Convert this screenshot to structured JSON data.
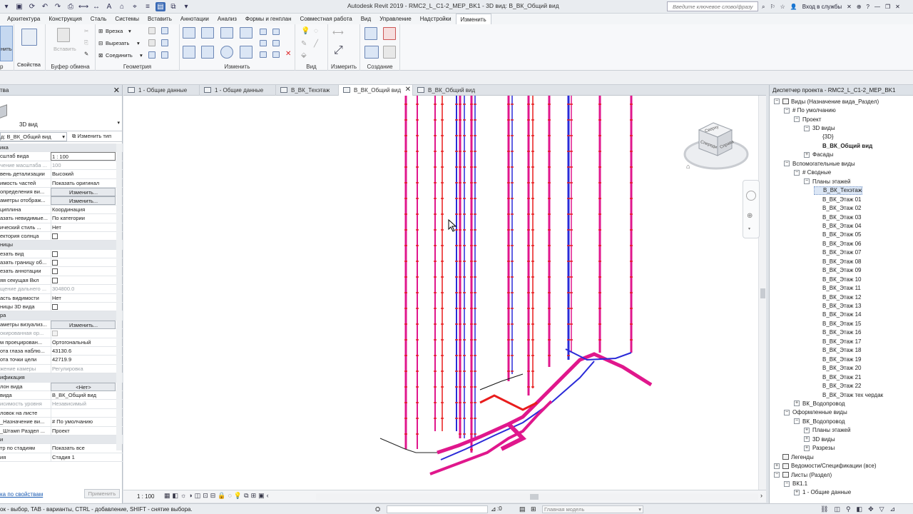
{
  "app": {
    "title": "Autodesk Revit 2019 - RMC2_L_C1-2_MEP_BK1 - 3D вид: B_ВК_Общий вид",
    "search_placeholder": "Введите ключевое слово/фразу",
    "signin": "Вход в службы"
  },
  "ribbon_tabs": [
    "Архитектура",
    "Конструкция",
    "Сталь",
    "Системы",
    "Вставить",
    "Аннотации",
    "Анализ",
    "Формы и генплан",
    "Совместная работа",
    "Вид",
    "Управление",
    "Надстройки",
    "Изменить"
  ],
  "ribbon_active_tab": "Изменить",
  "ribbon": {
    "modify_partial": "нить",
    "properties_label": "Свойства",
    "select_partial": "р",
    "clipboard_label": "Буфер обмена",
    "paste_label": "Вставить",
    "geometry_label": "Геометрия",
    "cut_label": "Врезка",
    "cutout_label": "Вырезать",
    "join_label": "Соединить",
    "modify_label": "Изменить",
    "view_label": "Вид",
    "measure_label": "Измерить",
    "create_label": "Создание"
  },
  "props": {
    "header": "тва",
    "type_name": "3D вид",
    "instance_select": "д: B_ВК_Общий вид",
    "edit_type": "Изменить тип",
    "rows": [
      {
        "kind": "group",
        "name": "ика"
      },
      {
        "name": "сштаб вида",
        "value": "1 : 100",
        "style": "boxed"
      },
      {
        "name": "чение масштаба ...",
        "value": "100",
        "style": "dis"
      },
      {
        "name": "вень детализации",
        "value": "Высокий"
      },
      {
        "name": "имость частей",
        "value": "Показать оригинал"
      },
      {
        "name": "определения ви...",
        "value": "Изменить...",
        "style": "btn"
      },
      {
        "name": "аметры отображ...",
        "value": "Изменить...",
        "style": "btn"
      },
      {
        "name": "циплина",
        "value": "Координация"
      },
      {
        "name": "азать невидимые...",
        "value": "По категории"
      },
      {
        "name": "ический стиль ...",
        "value": "Нет"
      },
      {
        "name": "ектория солнца",
        "value": "",
        "check": "on"
      },
      {
        "kind": "group",
        "name": "ницы"
      },
      {
        "name": "езать вид",
        "value": "",
        "check": "on"
      },
      {
        "name": "азать границу об...",
        "value": "",
        "check": "on"
      },
      {
        "name": "езать аннотации",
        "value": "",
        "check": "on"
      },
      {
        "name": "яя секущая Вкл",
        "value": "",
        "check": "on"
      },
      {
        "name": "щение дальнего ...",
        "value": "304800.0",
        "style": "dis"
      },
      {
        "name": "асть видимости",
        "value": "Нет"
      },
      {
        "name": "ницы 3D вида",
        "value": "",
        "check": "on"
      },
      {
        "kind": "group",
        "name": "ра"
      },
      {
        "name": "аметры визуализ...",
        "value": "Изменить...",
        "style": "btn"
      },
      {
        "name": "окированная ор...",
        "value": "",
        "check": "dis",
        "style": "dis"
      },
      {
        "name": "м проецирован...",
        "value": "Ортогональный"
      },
      {
        "name": "ота глаза наблю...",
        "value": "43130.6"
      },
      {
        "name": "ота точки цели",
        "value": "42719.9"
      },
      {
        "name": "жение камеры",
        "value": "Регулировка",
        "style": "dis"
      },
      {
        "kind": "group",
        "name": "ификация"
      },
      {
        "name": "лон вида",
        "value": "<Нет>",
        "style": "btn"
      },
      {
        "name": "вида",
        "value": "B_ВК_Общий вид"
      },
      {
        "name": "исимость уровня",
        "value": "Независимый",
        "style": "dis"
      },
      {
        "name": "ловок на листе",
        "value": ""
      },
      {
        "name": "_Назначение ви...",
        "value": "# По умолчанию"
      },
      {
        "name": "_Штамп Раздел ...",
        "value": "Проект"
      },
      {
        "kind": "group",
        "name": "и"
      },
      {
        "name": "тр по стадиям",
        "value": "Показать все"
      },
      {
        "name": "ия",
        "value": "Стадия 1"
      }
    ],
    "help_link": "ка по свойствам",
    "apply": "Применить"
  },
  "view_tabs": [
    {
      "label": "1 - Общие данные",
      "active": false
    },
    {
      "label": "1 - Общие данные",
      "active": false
    },
    {
      "label": "B_ВК_Техэтаж",
      "active": false
    },
    {
      "label": "B_ВК_Общий вид",
      "active": true
    },
    {
      "label": "B_ВК_Общий вид",
      "active": false
    }
  ],
  "viewcube": {
    "top": "Сверху",
    "front": "Спереди",
    "right": "Справа"
  },
  "view_scale": "1 : 100",
  "browser": {
    "title": "Диспетчер проекта - RMC2_L_C1-2_MEP_BK1",
    "nodes": [
      {
        "level": 0,
        "toggle": "−",
        "icon": true,
        "label": "Виды (Назначение вида_Раздел)"
      },
      {
        "level": 1,
        "toggle": "−",
        "label": "# По умолчанию"
      },
      {
        "level": 2,
        "toggle": "−",
        "label": "Проект"
      },
      {
        "level": 3,
        "toggle": "−",
        "label": "3D виды"
      },
      {
        "level": 4,
        "label": "{3D}"
      },
      {
        "level": 4,
        "label": "B_ВК_Общий вид",
        "bold": true
      },
      {
        "level": 3,
        "toggle": "+",
        "label": "Фасады"
      },
      {
        "level": 1,
        "toggle": "−",
        "label": "Вспомогательные виды"
      },
      {
        "level": 2,
        "toggle": "−",
        "label": "# Сводные"
      },
      {
        "level": 3,
        "toggle": "−",
        "label": "Планы этажей"
      },
      {
        "level": 4,
        "label": "B_ВК_Техэтаж",
        "selected": true
      },
      {
        "level": 4,
        "label": "B_ВК_Этаж 01"
      },
      {
        "level": 4,
        "label": "B_ВК_Этаж 02"
      },
      {
        "level": 4,
        "label": "B_ВК_Этаж 03"
      },
      {
        "level": 4,
        "label": "B_ВК_Этаж 04"
      },
      {
        "level": 4,
        "label": "B_ВК_Этаж 05"
      },
      {
        "level": 4,
        "label": "B_ВК_Этаж 06"
      },
      {
        "level": 4,
        "label": "B_ВК_Этаж 07"
      },
      {
        "level": 4,
        "label": "B_ВК_Этаж 08"
      },
      {
        "level": 4,
        "label": "B_ВК_Этаж 09"
      },
      {
        "level": 4,
        "label": "B_ВК_Этаж 10"
      },
      {
        "level": 4,
        "label": "B_ВК_Этаж 11"
      },
      {
        "level": 4,
        "label": "B_ВК_Этаж 12"
      },
      {
        "level": 4,
        "label": "B_ВК_Этаж 13"
      },
      {
        "level": 4,
        "label": "B_ВК_Этаж 14"
      },
      {
        "level": 4,
        "label": "B_ВК_Этаж 15"
      },
      {
        "level": 4,
        "label": "B_ВК_Этаж 16"
      },
      {
        "level": 4,
        "label": "B_ВК_Этаж 17"
      },
      {
        "level": 4,
        "label": "B_ВК_Этаж 18"
      },
      {
        "level": 4,
        "label": "B_ВК_Этаж 19"
      },
      {
        "level": 4,
        "label": "B_ВК_Этаж 20"
      },
      {
        "level": 4,
        "label": "B_ВК_Этаж 21"
      },
      {
        "level": 4,
        "label": "B_ВК_Этаж 22"
      },
      {
        "level": 4,
        "label": "B_ВК_Этаж тех чердак"
      },
      {
        "level": 2,
        "toggle": "+",
        "label": "ВК_Водопровод"
      },
      {
        "level": 1,
        "toggle": "−",
        "label": "Оформленные виды"
      },
      {
        "level": 2,
        "toggle": "−",
        "label": "ВК_Водопровод"
      },
      {
        "level": 3,
        "toggle": "+",
        "label": "Планы этажей"
      },
      {
        "level": 3,
        "toggle": "+",
        "label": "3D виды"
      },
      {
        "level": 3,
        "toggle": "+",
        "label": "Разрезы"
      },
      {
        "level": 0,
        "icon": true,
        "label": "Легенды"
      },
      {
        "level": 0,
        "toggle": "+",
        "icon": true,
        "label": "Ведомости/Спецификации (все)"
      },
      {
        "level": 0,
        "toggle": "−",
        "icon": true,
        "label": "Листы (Раздел)"
      },
      {
        "level": 1,
        "toggle": "−",
        "label": "ВК1.1"
      },
      {
        "level": 2,
        "toggle": "+",
        "label": "1 - Общие данные"
      }
    ]
  },
  "status": {
    "hint": "ок - выбор, TAB - варианты, CTRL - добавление, SHIFT - снятие выбора.",
    "count": ":0",
    "model": "Главная модель"
  },
  "colors": {
    "pipe_magenta": "#e0178c",
    "pipe_blue": "#2a2ad8",
    "pipe_red": "#e81c1c",
    "accent": "#3c6bb5"
  }
}
